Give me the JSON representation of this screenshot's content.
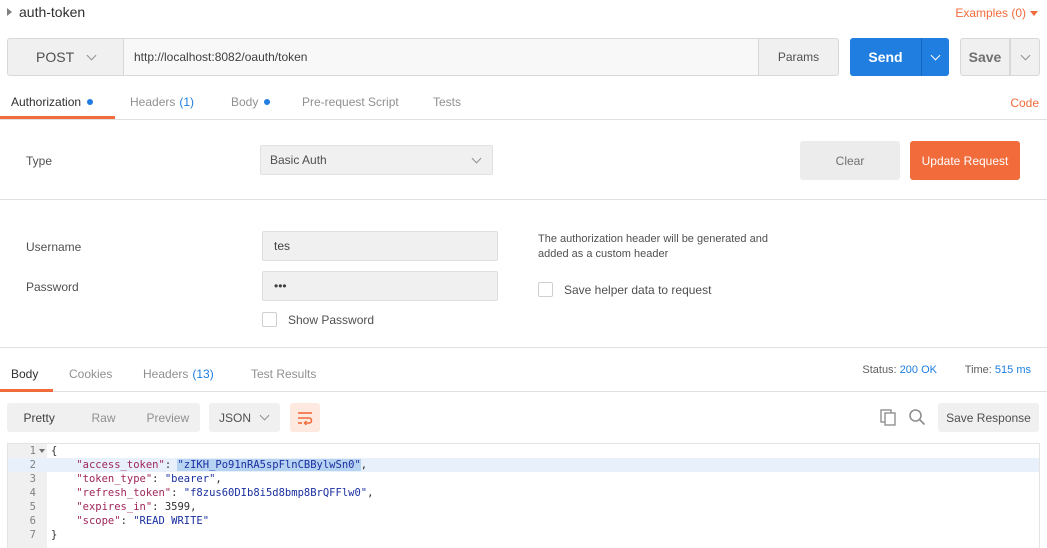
{
  "request": {
    "name": "auth-token",
    "examples_label": "Examples (0)",
    "method": "POST",
    "url": "http://localhost:8082/oauth/token",
    "params_label": "Params",
    "send_label": "Send",
    "save_label": "Save"
  },
  "request_tabs": {
    "authorization": "Authorization",
    "headers": "Headers",
    "headers_count": "(1)",
    "body": "Body",
    "prerequest": "Pre-request Script",
    "tests": "Tests",
    "code": "Code"
  },
  "auth": {
    "type_label": "Type",
    "type_value": "Basic Auth",
    "clear_label": "Clear",
    "update_label": "Update Request",
    "username_label": "Username",
    "username_value": "tes",
    "password_label": "Password",
    "password_value": "•••",
    "show_password_label": "Show Password",
    "hint": "The authorization header will be generated and added as a custom header",
    "save_helper_label": "Save helper data to request"
  },
  "response_tabs": {
    "body": "Body",
    "cookies": "Cookies",
    "headers": "Headers",
    "headers_count": "(13)",
    "test_results": "Test Results"
  },
  "response_meta": {
    "status_label": "Status:",
    "status_value": "200 OK",
    "time_label": "Time:",
    "time_value": "515 ms"
  },
  "response_toolbar": {
    "pretty": "Pretty",
    "raw": "Raw",
    "preview": "Preview",
    "format": "JSON",
    "save_response": "Save Response"
  },
  "response_body": {
    "open": "{",
    "close": "}",
    "fields": [
      {
        "key": "\"access_token\"",
        "value": "\"zIKH_Po91nRA5spFlnCBBylwSn0\"",
        "sep": ","
      },
      {
        "key": "\"token_type\"",
        "value": "\"bearer\"",
        "sep": ","
      },
      {
        "key": "\"refresh_token\"",
        "value": "\"f8zus60DIb8i5d8bmp8BrQFFlw0\"",
        "sep": ","
      },
      {
        "key": "\"expires_in\"",
        "value": "3599",
        "sep": ","
      },
      {
        "key": "\"scope\"",
        "value": "\"READ WRITE\"",
        "sep": ""
      }
    ],
    "line_numbers": [
      "1",
      "2",
      "3",
      "4",
      "5",
      "6",
      "7"
    ]
  },
  "colors": {
    "accent": "#f26b3a",
    "primary": "#1f7ee0"
  }
}
